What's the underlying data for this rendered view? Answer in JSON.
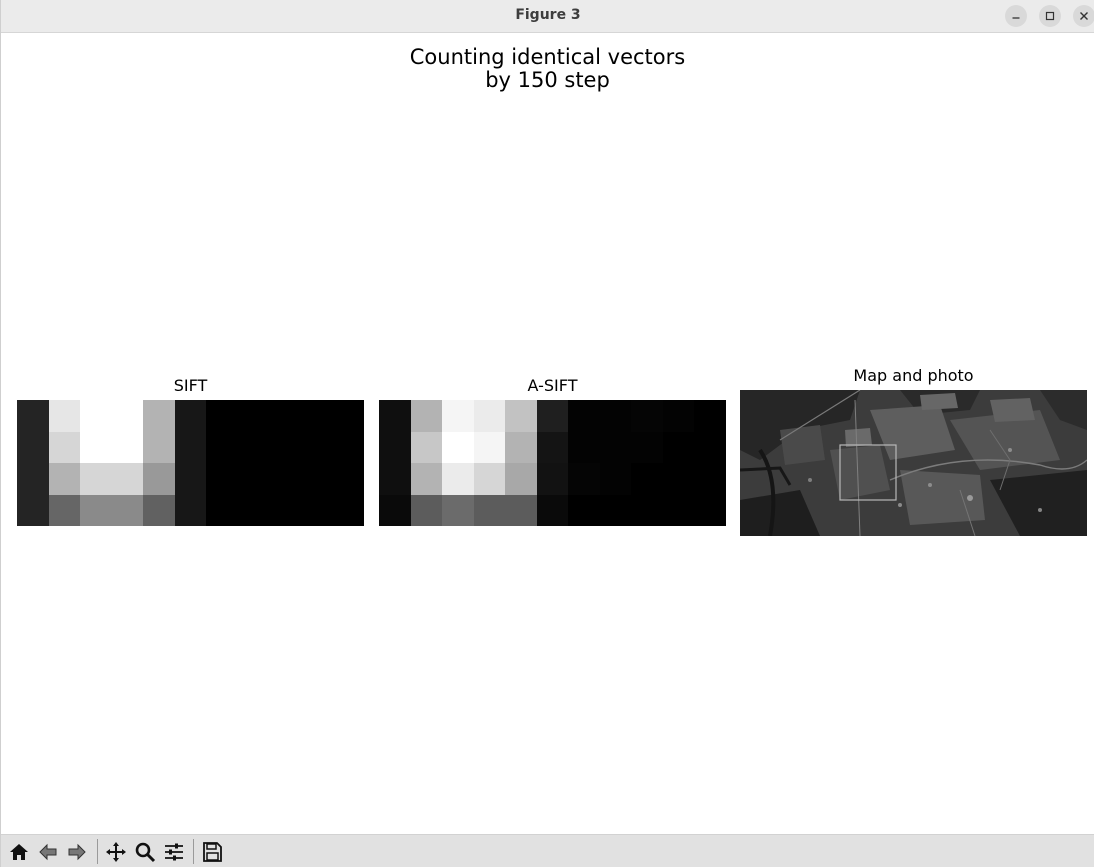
{
  "window": {
    "title": "Figure 3",
    "buttons": [
      "minimize-icon",
      "maximize-icon",
      "close-icon"
    ]
  },
  "figure": {
    "suptitle_line1": "Counting identical vectors",
    "suptitle_line2": "by 150 step"
  },
  "axes": {
    "sift": {
      "title": "SIFT",
      "rows": 4,
      "cols": 11,
      "values": [
        [
          0.14,
          0.9,
          1.0,
          1.0,
          0.7,
          0.09,
          0.0,
          0.0,
          0.0,
          0.0,
          0.0
        ],
        [
          0.14,
          0.84,
          1.0,
          1.0,
          0.7,
          0.09,
          0.0,
          0.0,
          0.0,
          0.0,
          0.0
        ],
        [
          0.14,
          0.7,
          0.84,
          0.84,
          0.6,
          0.09,
          0.0,
          0.0,
          0.0,
          0.0,
          0.0
        ],
        [
          0.14,
          0.4,
          0.54,
          0.54,
          0.38,
          0.09,
          0.0,
          0.0,
          0.0,
          0.0,
          0.0
        ]
      ]
    },
    "asift": {
      "title": "A-SIFT",
      "rows": 4,
      "cols": 11,
      "values": [
        [
          0.06,
          0.7,
          0.96,
          0.92,
          0.76,
          0.12,
          0.01,
          0.01,
          0.02,
          0.01,
          0.0
        ],
        [
          0.06,
          0.78,
          1.0,
          0.96,
          0.7,
          0.08,
          0.01,
          0.01,
          0.01,
          0.0,
          0.0
        ],
        [
          0.06,
          0.7,
          0.92,
          0.84,
          0.66,
          0.07,
          0.02,
          0.01,
          0.0,
          0.0,
          0.0
        ],
        [
          0.04,
          0.36,
          0.42,
          0.36,
          0.36,
          0.04,
          0.0,
          0.0,
          0.0,
          0.0,
          0.0
        ]
      ]
    },
    "map": {
      "title": "Map and photo"
    }
  },
  "toolbar": {
    "tools": [
      "home-icon",
      "back-icon",
      "forward-icon",
      "pan-icon",
      "zoom-icon",
      "configure-subplots-icon",
      "save-icon"
    ]
  },
  "colors": {
    "colormap": "gray",
    "titlebar_bg": "#ebebeb",
    "toolbar_bg": "#e1e1e1"
  }
}
